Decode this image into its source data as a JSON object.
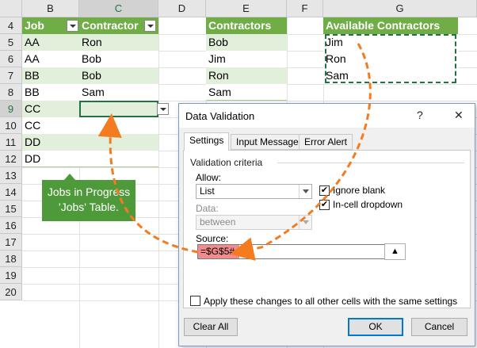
{
  "sheet": {
    "columns": [
      "B",
      "C",
      "D",
      "E",
      "F",
      "G"
    ],
    "rows": [
      "4",
      "5",
      "6",
      "7",
      "8",
      "9",
      "10",
      "11",
      "12",
      "13",
      "14",
      "15",
      "16",
      "17",
      "18",
      "19",
      "20"
    ],
    "jobs_table": {
      "headers": [
        "Job",
        "Contractor"
      ],
      "rows": [
        [
          "AA",
          "Ron"
        ],
        [
          "AA",
          "Bob"
        ],
        [
          "BB",
          "Bob"
        ],
        [
          "BB",
          "Sam"
        ],
        [
          "CC",
          ""
        ],
        [
          "CC",
          ""
        ],
        [
          "DD",
          ""
        ],
        [
          "DD",
          ""
        ]
      ]
    },
    "contractors_table": {
      "header": "Contractors",
      "items": [
        "Bob",
        "Jim",
        "Ron",
        "Sam"
      ]
    },
    "available_table": {
      "header": "Available Contractors",
      "items": [
        "Jim",
        "Ron",
        "Sam"
      ]
    }
  },
  "callout": {
    "line1": "Jobs in Progress",
    "line2": "'Jobs' Table."
  },
  "dialog": {
    "title": "Data Validation",
    "help_glyph": "?",
    "close_glyph": "✕",
    "tabs": [
      "Settings",
      "Input Message",
      "Error Alert"
    ],
    "section": "Validation criteria",
    "allow_label": "Allow:",
    "allow_value": "List",
    "data_label": "Data:",
    "data_value": "between",
    "ignore_blank": "Ignore blank",
    "in_cell_dropdown": "In-cell dropdown",
    "source_label": "Source:",
    "source_value": "=$G$5#",
    "apply_all": "Apply these changes to all other cells with the same settings",
    "clear_all": "Clear All",
    "ok": "OK",
    "cancel": "Cancel"
  },
  "colors": {
    "header_green": "#70ad47",
    "band_green": "#e2efda",
    "arrow_orange": "#f47b20",
    "source_highlight": "#f28b8b",
    "callout_green": "#4e9a3b"
  }
}
